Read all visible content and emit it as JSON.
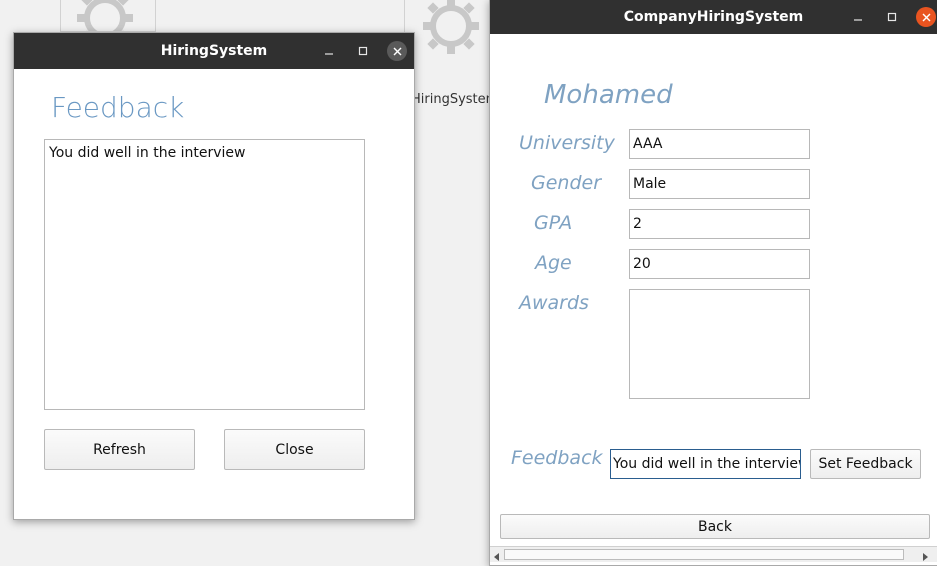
{
  "desktop": {
    "bg_label": "HiringSystem"
  },
  "feedback_window": {
    "title": "HiringSystem",
    "heading": "Feedback",
    "feedback_text": "You did well in the interview",
    "refresh_label": "Refresh",
    "close_label": "Close"
  },
  "main_window": {
    "title": "CompanyHiringSystem",
    "candidate_name": "Mohamed",
    "fields": {
      "university_label": "University",
      "university_value": "AAA",
      "gender_label": "Gender",
      "gender_value": "Male",
      "gpa_label": "GPA",
      "gpa_value": "2",
      "age_label": "Age",
      "age_value": "20",
      "awards_label": "Awards",
      "awards_value": ""
    },
    "feedback_label": "Feedback",
    "feedback_value": "You did well in the interview",
    "set_feedback_label": "Set Feedback",
    "back_label": "Back"
  },
  "icons": {
    "gear": "gear-icon",
    "minimize": "minimize-icon",
    "maximize": "maximize-icon",
    "close": "close-icon",
    "scroll_left": "arrow-left-icon",
    "scroll_right": "arrow-right-icon"
  },
  "colors": {
    "titlebar": "#303030",
    "label_blue": "#7fa2c2",
    "close_orange": "#e95420",
    "close_gray": "#5a5a5a",
    "focus_border": "#2a5d8f"
  }
}
